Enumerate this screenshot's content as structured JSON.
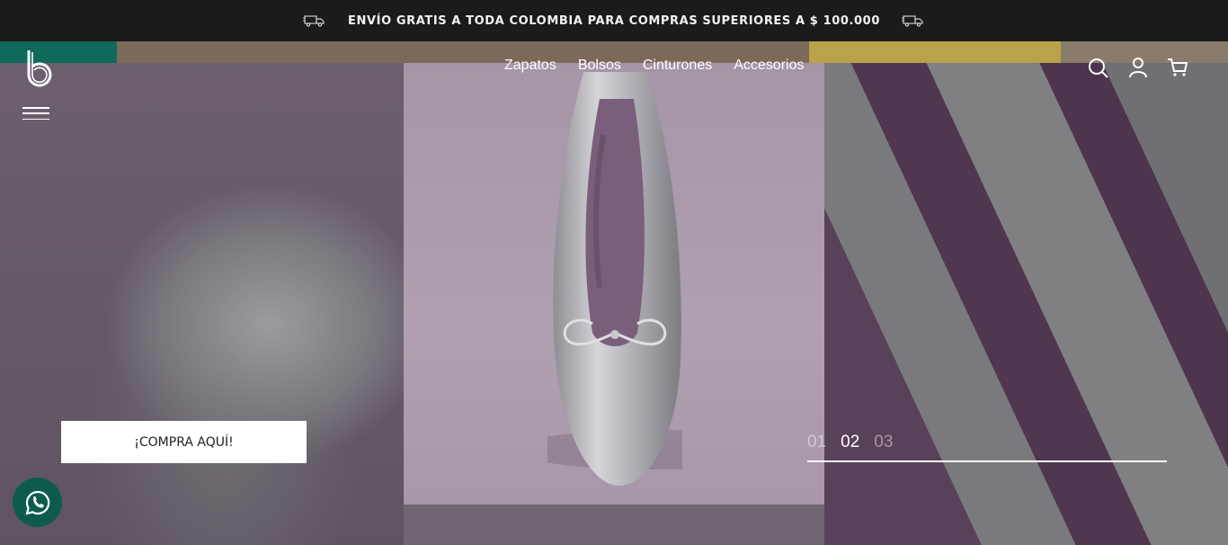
{
  "announcement": {
    "text": "ENVÍO GRATIS A TODA COLOMBIA PARA COMPRAS SUPERIORES A $ 100.000",
    "icon": "truck-icon"
  },
  "header": {
    "logo_icon": "brand-b-logo",
    "menu_icon": "hamburger-menu-icon",
    "nav": [
      {
        "label": "Zapatos"
      },
      {
        "label": "Bolsos"
      },
      {
        "label": "Cinturones"
      },
      {
        "label": "Accesorios"
      }
    ],
    "icons": [
      "search-icon",
      "user-icon",
      "cart-icon"
    ]
  },
  "hero": {
    "cta_label": "¡COMPRA AQUÍ!",
    "slides": [
      "01",
      "02",
      "03"
    ],
    "active_slide": 1
  },
  "floating": {
    "whatsapp_icon": "whatsapp-icon"
  },
  "colors": {
    "topbar_bg": "#1b1b1b",
    "whatsapp_bg": "#0d5c4b",
    "cta_bg": "#ffffff"
  }
}
